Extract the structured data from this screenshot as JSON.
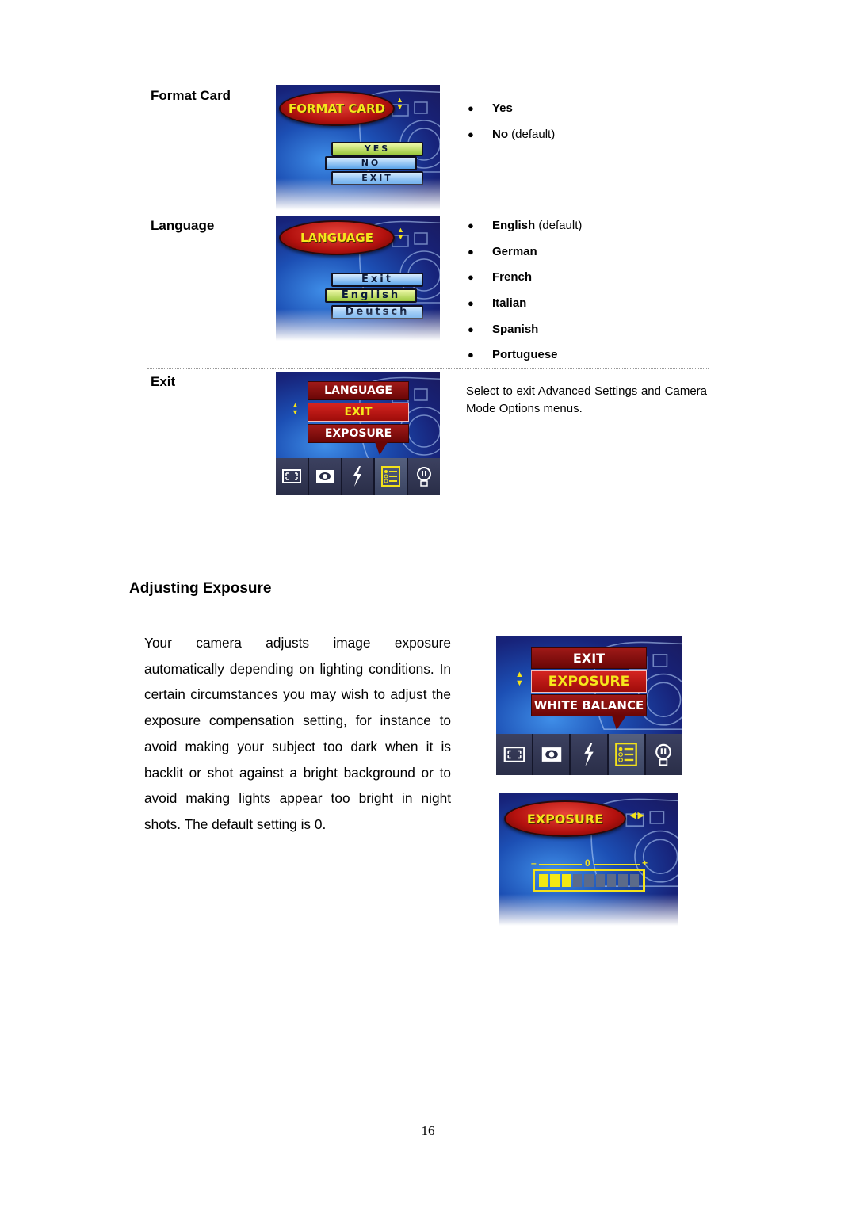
{
  "settings_table": {
    "rows": [
      {
        "label": "Format Card",
        "screen": {
          "title": "FORMAT CARD",
          "options": [
            {
              "label": "YES",
              "selected": true
            },
            {
              "label": "NO",
              "selected": false
            },
            {
              "label": "EXIT",
              "selected": false
            }
          ]
        },
        "bullets": [
          {
            "name": "Yes",
            "extra": ""
          },
          {
            "name": "No",
            "extra": " (default)"
          }
        ]
      },
      {
        "label": "Language",
        "screen": {
          "title": "LANGUAGE",
          "options": [
            {
              "label": "Exit",
              "selected": false
            },
            {
              "label": "English",
              "selected": true
            },
            {
              "label": "Deutsch",
              "selected": false
            }
          ]
        },
        "bullets": [
          {
            "name": "English",
            "extra": " (default)"
          },
          {
            "name": "German",
            "extra": ""
          },
          {
            "name": "French",
            "extra": ""
          },
          {
            "name": "Italian",
            "extra": ""
          },
          {
            "name": "Spanish",
            "extra": ""
          },
          {
            "name": "Portuguese",
            "extra": ""
          }
        ]
      },
      {
        "label": "Exit",
        "screen": {
          "menu": [
            {
              "label": "LANGUAGE",
              "selected": false
            },
            {
              "label": "EXIT",
              "selected": true
            },
            {
              "label": "EXPOSURE",
              "selected": false
            }
          ],
          "icons": [
            "frame-size-icon",
            "quality-icon",
            "flash-icon",
            "menu-list-icon",
            "lightbulb-icon"
          ],
          "selected_icon": 3
        },
        "description": "Select to exit Advanced Settings and Camera Mode Options menus."
      }
    ]
  },
  "section": {
    "heading": "Adjusting Exposure",
    "paragraph": "Your camera adjusts image exposure automatically depending on lighting conditions. In certain circumstances you may wish to adjust the exposure compensation setting, for instance to avoid making your subject too dark when it is backlit or shot against a bright background or to avoid making lights appear too bright in night shots. The default setting is 0.",
    "menu_screen": {
      "menu": [
        {
          "label": "EXIT",
          "selected": false
        },
        {
          "label": "EXPOSURE",
          "selected": true
        },
        {
          "label": "WHITE BALANCE",
          "selected": false
        }
      ],
      "icons": [
        "frame-size-icon",
        "quality-icon",
        "flash-icon",
        "menu-list-icon",
        "lightbulb-icon"
      ],
      "selected_icon": 3
    },
    "exposure_screen": {
      "title": "EXPOSURE",
      "scale_minus": "–",
      "scale_zero": "0",
      "scale_plus": "+",
      "total_segments": 9,
      "filled_segments": 3
    }
  },
  "page_number": "16"
}
